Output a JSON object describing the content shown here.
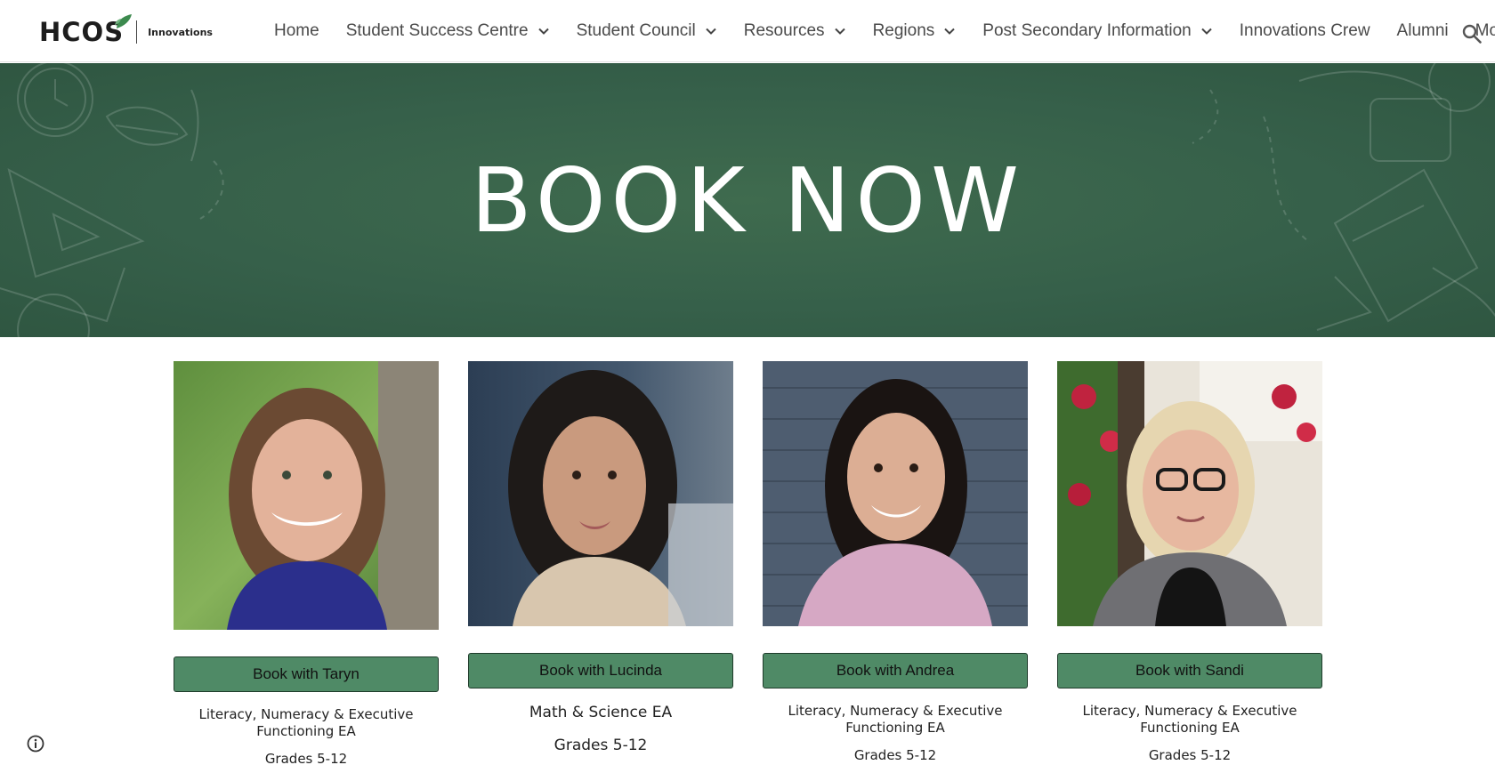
{
  "header": {
    "logo_text": "HCOS",
    "logo_sub": "Innovations",
    "nav": [
      {
        "label": "Home",
        "has_dropdown": false
      },
      {
        "label": "Student Success Centre",
        "has_dropdown": true
      },
      {
        "label": "Student Council",
        "has_dropdown": true
      },
      {
        "label": "Resources",
        "has_dropdown": true
      },
      {
        "label": "Regions",
        "has_dropdown": true
      },
      {
        "label": "Post Secondary Information",
        "has_dropdown": true
      },
      {
        "label": "Innovations Crew",
        "has_dropdown": false
      },
      {
        "label": "Alumni",
        "has_dropdown": false
      },
      {
        "label": "More",
        "has_dropdown": true
      }
    ],
    "search_icon": "search-icon"
  },
  "hero": {
    "title": "BOOK NOW"
  },
  "cards": [
    {
      "button": "Book with Taryn",
      "role": "Literacy, Numeracy & Executive Functioning EA",
      "grades": "Grades 5-12"
    },
    {
      "button": "Book with Lucinda",
      "role": "Math & Science EA",
      "grades": "Grades 5-12"
    },
    {
      "button": "Book with Andrea",
      "role": "Literacy, Numeracy & Executive Functioning EA",
      "grades": "Grades 5-12"
    },
    {
      "button": "Book with Sandi",
      "role": "Literacy, Numeracy & Executive Functioning EA",
      "grades": "Grades 5-12"
    }
  ],
  "colors": {
    "brand_green": "#4f8a66",
    "hero_green": "#36604a",
    "leaf_green": "#3c8a4e"
  }
}
